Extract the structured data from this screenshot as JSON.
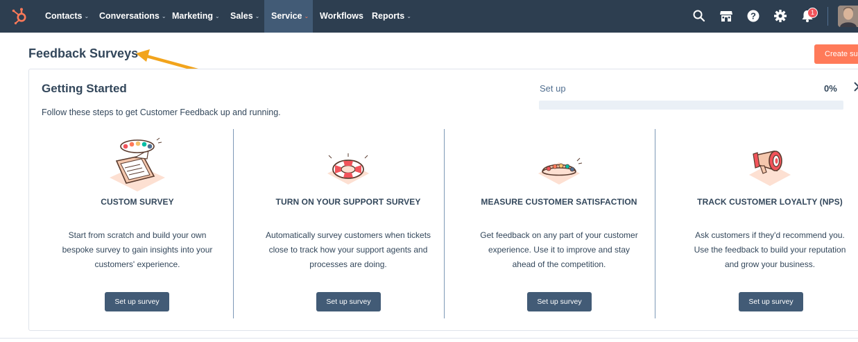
{
  "nav": {
    "items": [
      {
        "label": "Contacts",
        "chevron": "⌄"
      },
      {
        "label": "Conversations",
        "chevron": "⌄"
      },
      {
        "label": "Marketing",
        "chevron": "⌄"
      },
      {
        "label": "Sales",
        "chevron": "⌄"
      },
      {
        "label": "Service",
        "chevron": "⌄"
      },
      {
        "label": "Workflows",
        "chevron": ""
      },
      {
        "label": "Reports",
        "chevron": "⌄"
      }
    ],
    "active": "Service",
    "notification_count": "1",
    "icons": [
      "search-icon",
      "marketplace-icon",
      "help-icon",
      "settings-icon",
      "notifications-icon"
    ]
  },
  "header": {
    "title": "Feedback Surveys",
    "create_button": "Create survey"
  },
  "getting_started": {
    "title": "Getting Started",
    "subtitle": "Follow these steps to get Customer Feedback up and running.",
    "setup_label": "Set up",
    "setup_percent": "0%",
    "progress": 0
  },
  "steps": [
    {
      "title": "CUSTOM SURVEY",
      "description": "Start from scratch and build your own bespoke survey to gain insights into your customers' experience.",
      "button": "Set up survey",
      "icon": "clipboard-survey-icon"
    },
    {
      "title": "TURN ON YOUR SUPPORT SURVEY",
      "description": "Automatically survey customers when tickets close to track how your support agents and processes are doing.",
      "button": "Set up survey",
      "icon": "lifebuoy-icon"
    },
    {
      "title": "MEASURE CUSTOMER SATISFACTION",
      "description": "Get feedback on any part of your customer experience. Use it to improve and stay ahead of the competition.",
      "button": "Set up survey",
      "icon": "satisfaction-scale-icon"
    },
    {
      "title": "TRACK CUSTOMER LOYALTY (NPS)",
      "description": "Ask customers if they'd recommend you. Use the feedback to build your reputation and grow your business.",
      "button": "Set up survey",
      "icon": "megaphone-icon"
    }
  ],
  "colors": {
    "nav_bg": "#2d3e50",
    "accent": "#ff7a59",
    "button_bg": "#425b76",
    "text": "#33475b"
  }
}
